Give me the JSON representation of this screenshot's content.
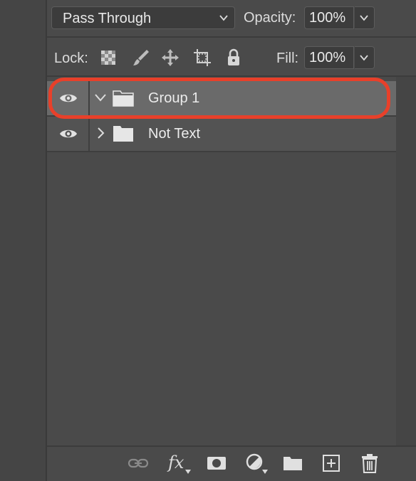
{
  "top_bar": {
    "blend_mode": "Pass Through",
    "opacity_label": "Opacity:",
    "opacity_value": "100%"
  },
  "lock_bar": {
    "lock_label": "Lock:",
    "lock_icons": [
      "lock-transparent-pixels-icon",
      "lock-image-pixels-icon",
      "lock-position-icon",
      "lock-artboard-icon",
      "lock-all-icon"
    ],
    "fill_label": "Fill:",
    "fill_value": "100%"
  },
  "layers": [
    {
      "name": "Group 1",
      "visible": true,
      "expanded": true,
      "selected": true,
      "type": "group"
    },
    {
      "name": "Not Text",
      "visible": true,
      "expanded": false,
      "selected": false,
      "type": "group"
    }
  ],
  "bottom_toolbar": {
    "icons": [
      "link-layers-icon",
      "fx-icon",
      "layer-mask-icon",
      "adjustment-layer-icon",
      "new-group-icon",
      "new-layer-icon",
      "trash-icon"
    ],
    "fx_label": "fx"
  },
  "colors": {
    "highlight_ring": "#e8402a",
    "panel_bg": "#4a4a4a",
    "selected_row": "#6a6a6a"
  }
}
